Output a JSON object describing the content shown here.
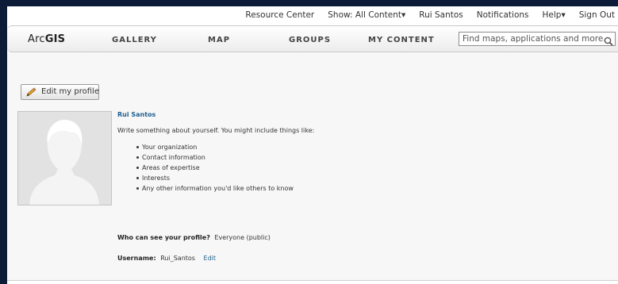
{
  "topbar": {
    "links": [
      "Resource Center",
      "Show: All Content▾",
      "Rui Santos",
      "Notifications",
      "Help▾",
      "Sign Out"
    ]
  },
  "nav": {
    "logo_prefix": "Arc",
    "logo_suffix": "GIS",
    "items": [
      "GALLERY",
      "MAP",
      "GROUPS",
      "MY CONTENT"
    ],
    "search_placeholder": "Find maps, applications and more..."
  },
  "profile": {
    "edit_label": "Edit my profile",
    "name": "Rui Santos",
    "description": "Write something about yourself. You might include things like:",
    "bullets": [
      "Your organization",
      "Contact information",
      "Areas of expertise",
      "Interests",
      "Any other information you'd like others to know"
    ],
    "visibility_label": "Who can see your profile?",
    "visibility_value": "Everyone (public)",
    "username_label": "Username:",
    "username_value": "Rui_Santos",
    "username_edit": "Edit"
  },
  "icons": {
    "search": "search-icon",
    "pencil": "pencil-icon",
    "avatar": "avatar-placeholder"
  }
}
